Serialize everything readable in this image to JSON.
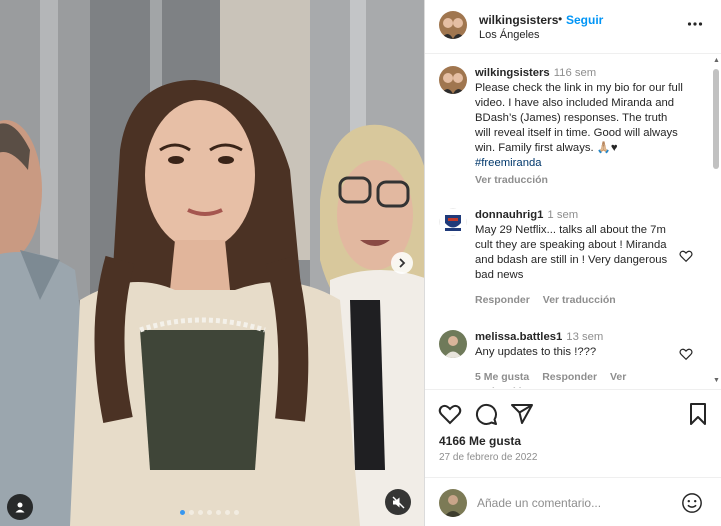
{
  "post": {
    "username": "wilkingsisters",
    "separator": "•",
    "follow_label": "Seguir",
    "location": "Los Ángeles",
    "more_icon": "more-horizontal-icon"
  },
  "media": {
    "carousel_total": 7,
    "carousel_active": 0,
    "accent_color": "#3797f0"
  },
  "comments": [
    {
      "author": "wilkingsisters",
      "time": "116 sem",
      "text": "Please check the link in my bio for our full video. I have also included Miranda and BDash’s (James) responses. The truth will reveal itself in time. Good will always win. Family first always. 🙏🏼♥",
      "hashtag": "#freemiranda",
      "translate": "Ver traducción"
    },
    {
      "author": "donnauhrig1",
      "time": "1 sem",
      "text": "May 29 Netflix... talks all about the 7m cult they are speaking about ! Miranda and bdash are still in ! Very dangerous bad news",
      "reply": "Responder",
      "translate": "Ver traducción"
    },
    {
      "author": "melissa.battles1",
      "time": "13 sem",
      "text": "Any updates to this !???",
      "likes": "5 Me gusta",
      "reply": "Responder",
      "translate": "Ver traducción"
    }
  ],
  "actions": {
    "likes": "4166 Me gusta",
    "date": "27 de febrero de 2022"
  },
  "composer": {
    "placeholder": "Añade un comentario..."
  }
}
